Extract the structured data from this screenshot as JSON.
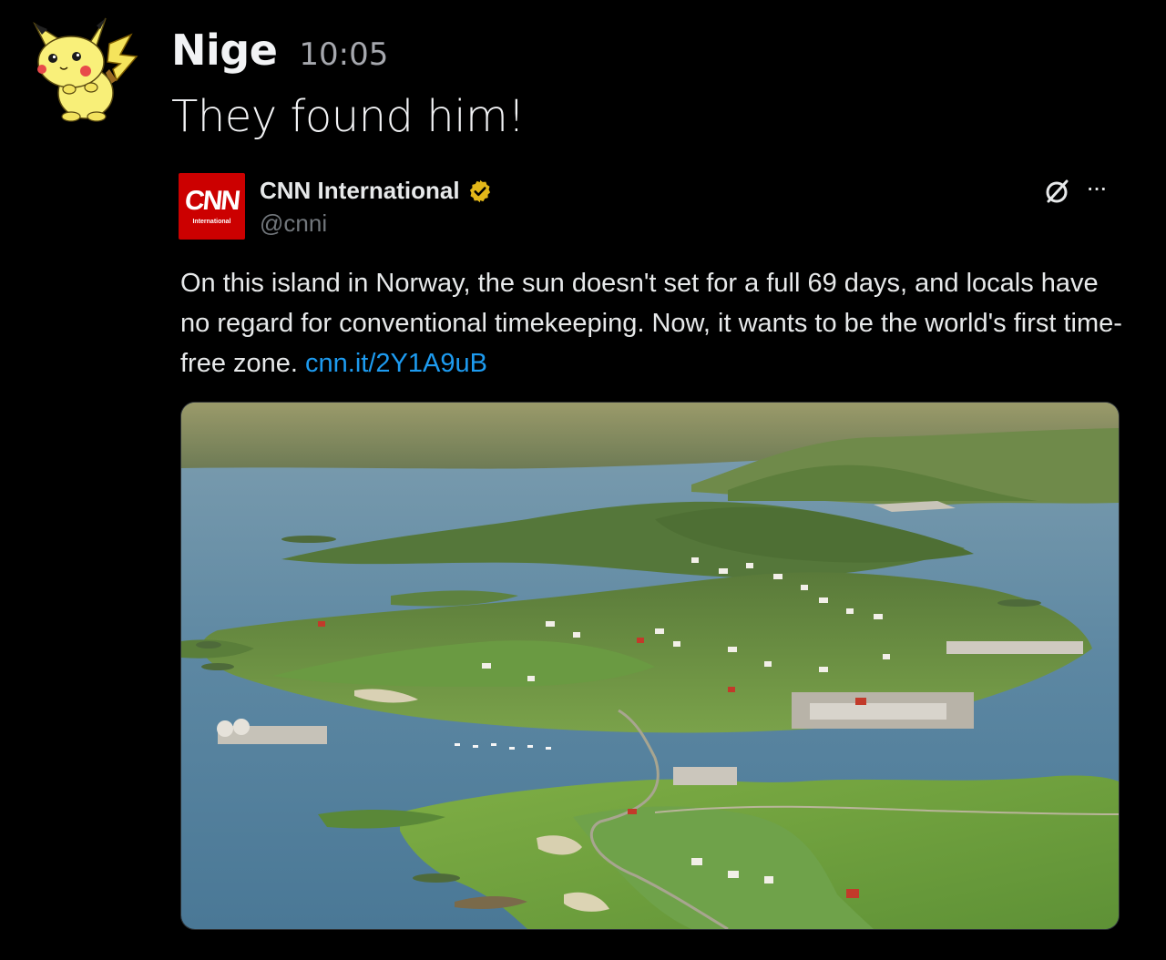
{
  "message": {
    "author": "Nige",
    "timestamp": "10:05",
    "text": "They found him!",
    "avatar_icon": "pikachu-avatar-icon"
  },
  "tweet": {
    "logo_text": "CNN",
    "logo_subtext": "International",
    "account_name": "CNN International",
    "verified_icon": "gold-verified-badge-icon",
    "handle": "@cnni",
    "grok_icon": "grok-slash-icon",
    "more_icon": "more-options-icon",
    "more_label": "···",
    "text": "On this island in Norway, the sun doesn't set for a full 69 days, and locals have no regard for conventional timekeeping. Now, it wants to be the world's first time-free zone. ",
    "link": "cnn.it/2Y1A9uB",
    "media_alt": "aerial photo of island village in Norway"
  },
  "colors": {
    "background": "#000000",
    "link": "#1d9bf0",
    "cnn_red": "#cc0000",
    "verified_gold": "#e2b719",
    "muted": "#71767b"
  }
}
